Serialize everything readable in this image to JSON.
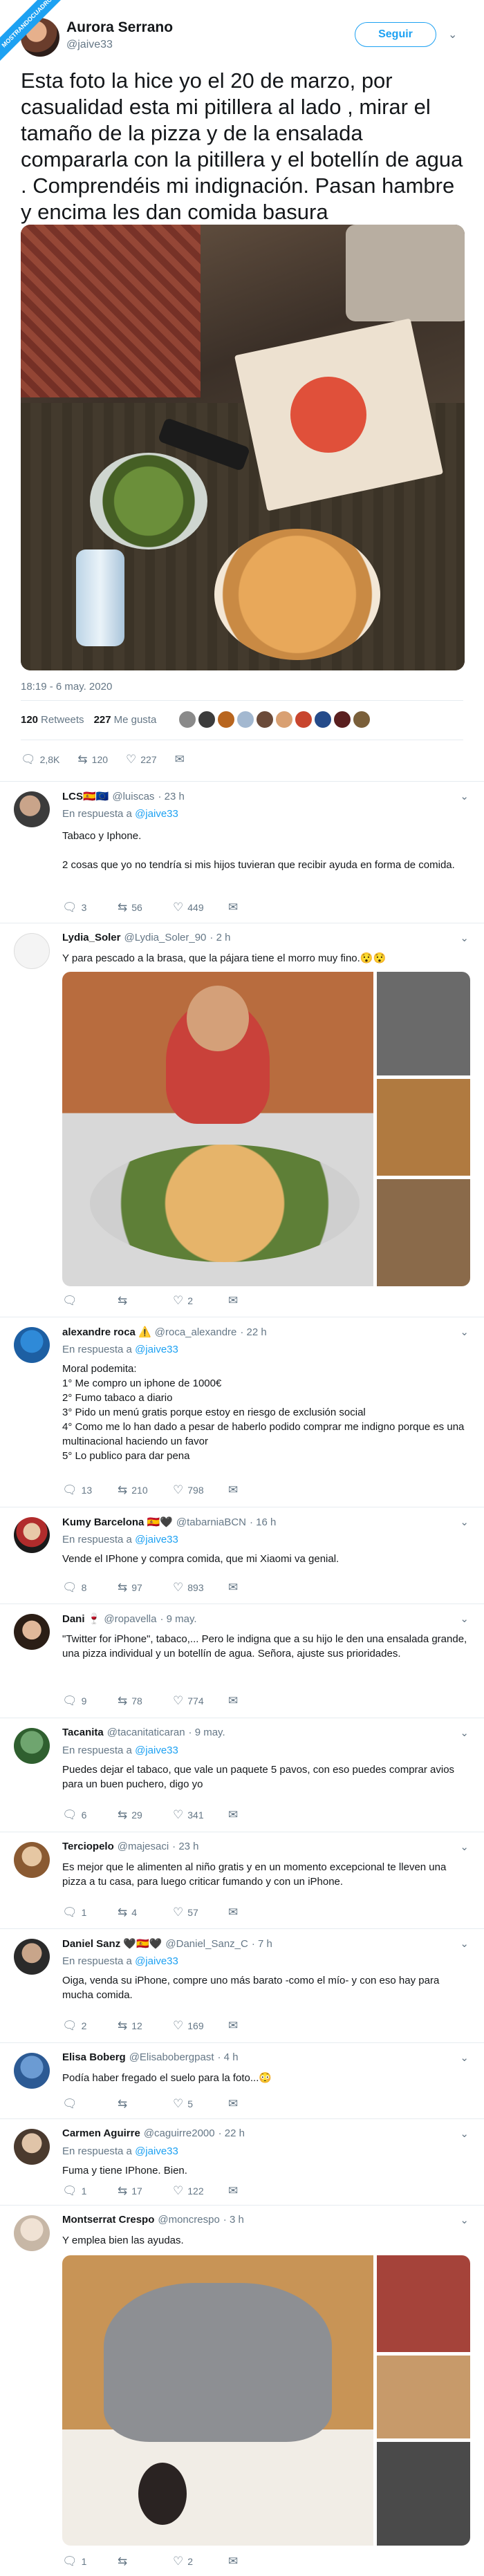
{
  "badge": "MOSTRANDOCUADROS",
  "tweet": {
    "name": "Aurora Serrano",
    "handle": "@jaive33",
    "follow_label": "Seguir",
    "text": "Esta foto la hice yo el 20 de marzo, por casualidad esta mi pitillera al lado , mirar el tamaño de la pizza y de la ensalada compararla  con la pitillera y el botellín de agua . Comprendéis mi indignación. Pasan hambre y encima les dan comida basura",
    "timestamp": "18:19 - 6 may. 2020",
    "retweets_count": "120",
    "retweets_label": "Retweets",
    "likes_count": "227",
    "likes_label": "Me gusta",
    "replies": "2,8K",
    "rts": "120",
    "likes": "227"
  },
  "replies": [
    {
      "name": "LCS🇪🇸🇪🇺",
      "handle": "@luiscas",
      "time": "· 23 h",
      "in_reply_prefix": "En respuesta a",
      "in_reply_to": "@jaive33",
      "text": "Tabaco y Iphone.\n\n2 cosas que yo no tendría si mis hijos tuvieran que recibir ayuda en forma de comida.",
      "replies": "3",
      "rts": "56",
      "likes": "449"
    },
    {
      "name": "Lydia_Soler",
      "handle": "@Lydia_Soler_90",
      "time": "· 2 h",
      "text": "Y para pescado a la brasa, que la pájara tiene el morro muy fino.😯😯",
      "replies": "",
      "rts": "",
      "likes": "2"
    },
    {
      "name": "alexandre roca ⚠️",
      "handle": "@roca_alexandre",
      "time": "· 22 h",
      "in_reply_prefix": "En respuesta a",
      "in_reply_to": "@jaive33",
      "text": "Moral podemita:\n1° Me compro un iphone de 1000€\n2° Fumo tabaco a diario\n3° Pido un menú gratis porque estoy en riesgo de exclusión social\n4° Como me lo han dado a pesar de haberlo podido comprar me indigno porque es una multinacional haciendo un favor\n5° Lo publico para dar pena",
      "replies": "13",
      "rts": "210",
      "likes": "798"
    },
    {
      "name": "Kumy Barcelona 🇪🇸🖤",
      "handle": "@tabarniaBCN",
      "time": "· 16 h",
      "in_reply_prefix": "En respuesta a",
      "in_reply_to": "@jaive33",
      "text": "Vende el IPhone y compra comida, que mi Xiaomi va genial.",
      "replies": "8",
      "rts": "97",
      "likes": "893"
    },
    {
      "name": "Dani 🍷",
      "handle": "@ropavella",
      "time": "· 9 may.",
      "text": "\"Twitter for iPhone\", tabaco,... Pero le indigna que a su hijo le den una ensalada grande, una pizza individual y un botellín de agua. Señora, ajuste sus prioridades.",
      "replies": "9",
      "rts": "78",
      "likes": "774"
    },
    {
      "name": "Tacanita",
      "handle": "@tacanitaticaran",
      "time": "· 9 may.",
      "in_reply_prefix": "En respuesta a",
      "in_reply_to": "@jaive33",
      "text": "Puedes dejar el tabaco, que vale un paquete 5 pavos, con eso puedes comprar avios para un buen puchero, digo yo",
      "replies": "6",
      "rts": "29",
      "likes": "341"
    },
    {
      "name": "Terciopelo",
      "handle": "@majesaci",
      "time": "· 23 h",
      "text": "Es mejor que le alimenten al niño gratis y en un momento excepcional te lleven una pizza a tu casa, para luego criticar fumando y con un iPhone.",
      "replies": "1",
      "rts": "4",
      "likes": "57"
    },
    {
      "name": "Daniel Sanz 🖤🇪🇸🖤",
      "handle": "@Daniel_Sanz_C",
      "time": "· 7 h",
      "in_reply_prefix": "En respuesta a",
      "in_reply_to": "@jaive33",
      "text": "Oiga, venda su iPhone, compre uno más barato -como el mío- y con eso hay para mucha comida.",
      "replies": "2",
      "rts": "12",
      "likes": "169"
    },
    {
      "name": "Elisa Boberg",
      "handle": "@Elisabobergpast",
      "time": "· 4 h",
      "text": "Podía haber fregado el suelo para la foto...😳",
      "replies": "",
      "rts": "",
      "likes": "5"
    },
    {
      "name": "Carmen Aguirre",
      "handle": "@caguirre2000",
      "time": "· 22 h",
      "in_reply_prefix": "En respuesta a",
      "in_reply_to": "@jaive33",
      "text": "Fuma y tiene IPhone. Bien.",
      "replies": "1",
      "rts": "17",
      "likes": "122"
    },
    {
      "name": "Montserrat Crespo",
      "handle": "@moncrespo",
      "time": "· 3 h",
      "text": "Y emplea bien las ayudas.",
      "replies": "1",
      "rts": "",
      "likes": "2"
    }
  ]
}
